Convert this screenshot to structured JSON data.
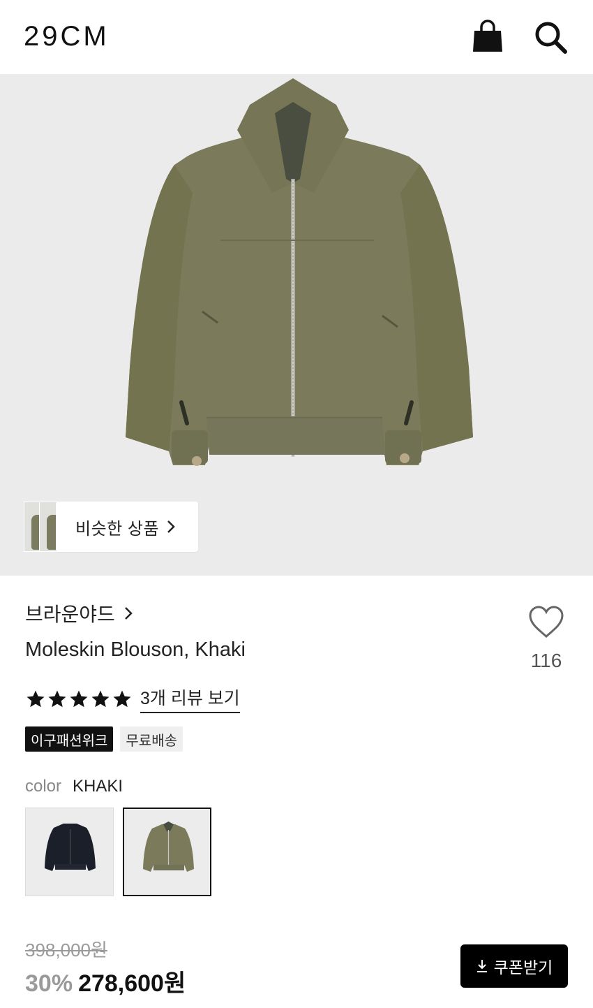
{
  "header": {
    "logo": "29CM",
    "cart_icon": "shopping-bag-icon",
    "search_icon": "search-icon"
  },
  "similar": {
    "label": "비슷한 상품"
  },
  "product": {
    "brand": "브라운야드",
    "title": "Moleskin Blouson, Khaki",
    "likes": "116",
    "rating_stars": 5,
    "review_link": "3개 리뷰 보기",
    "tags": [
      "이구패션위크",
      "무료배송"
    ],
    "color_label": "color",
    "color_value": "KHAKI",
    "swatches": [
      {
        "name": "navy",
        "selected": false,
        "color": "#1b1f2a"
      },
      {
        "name": "khaki",
        "selected": true,
        "color": "#7b7b5c"
      }
    ]
  },
  "price": {
    "original": "398,000원",
    "discount": "30%",
    "sale": "278,600원"
  },
  "coupon": {
    "label": "쿠폰받기"
  },
  "colors": {
    "jacket": "#7b7b5c",
    "hero_bg": "#ebebeb"
  }
}
